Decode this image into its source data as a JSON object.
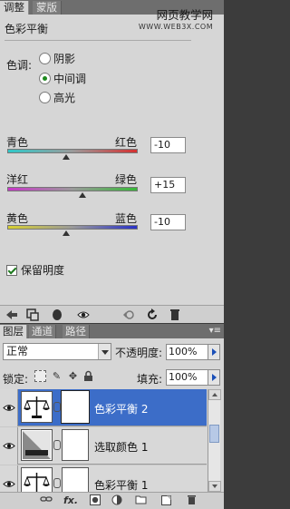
{
  "adjustments_panel": {
    "tabs": [
      "调整",
      "蒙版"
    ],
    "title": "色彩平衡",
    "tone_label": "色调:",
    "tone_options": [
      {
        "label": "阴影",
        "selected": false
      },
      {
        "label": "中间调",
        "selected": true
      },
      {
        "label": "高光",
        "selected": false
      }
    ],
    "sliders": [
      {
        "left_label": "青色",
        "right_label": "红色",
        "value": "-10",
        "min": -100,
        "max": 100
      },
      {
        "left_label": "洋红",
        "right_label": "绿色",
        "value": "+15",
        "min": -100,
        "max": 100
      },
      {
        "left_label": "黄色",
        "right_label": "蓝色",
        "value": "-10",
        "min": -100,
        "max": 100
      }
    ],
    "preserve_luminosity": {
      "label": "保留明度",
      "checked": true
    },
    "footer_icons": [
      "back-icon",
      "expanded-view-icon",
      "clip-to-layer-icon",
      "visibility-eye-icon",
      "view-previous-icon",
      "reset-icon",
      "trash-icon"
    ]
  },
  "watermark": {
    "line1": "网页教学网",
    "line2": "WWW.WEB3X.COM"
  },
  "layers_panel": {
    "tabs": [
      "图层",
      "通道",
      "路径"
    ],
    "menu_icon": "panel-menu-icon",
    "blend_mode": "正常",
    "opacity_label": "不透明度:",
    "opacity_value": "100%",
    "lock_label": "锁定:",
    "lock_icons": [
      "lock-transparent-icon",
      "lock-image-icon",
      "lock-position-icon",
      "lock-all-icon"
    ],
    "fill_label": "填充:",
    "fill_value": "100%",
    "layers": [
      {
        "name": "色彩平衡 2",
        "type": "color-balance",
        "selected": true
      },
      {
        "name": "选取颜色 1",
        "type": "selective-color",
        "selected": false
      },
      {
        "name": "色彩平衡 1",
        "type": "color-balance",
        "selected": false
      }
    ],
    "footer_icons": [
      "link-layers-icon",
      "fx-icon",
      "add-mask-icon",
      "adjustment-layer-icon",
      "group-folder-icon",
      "new-layer-icon",
      "delete-icon"
    ]
  }
}
